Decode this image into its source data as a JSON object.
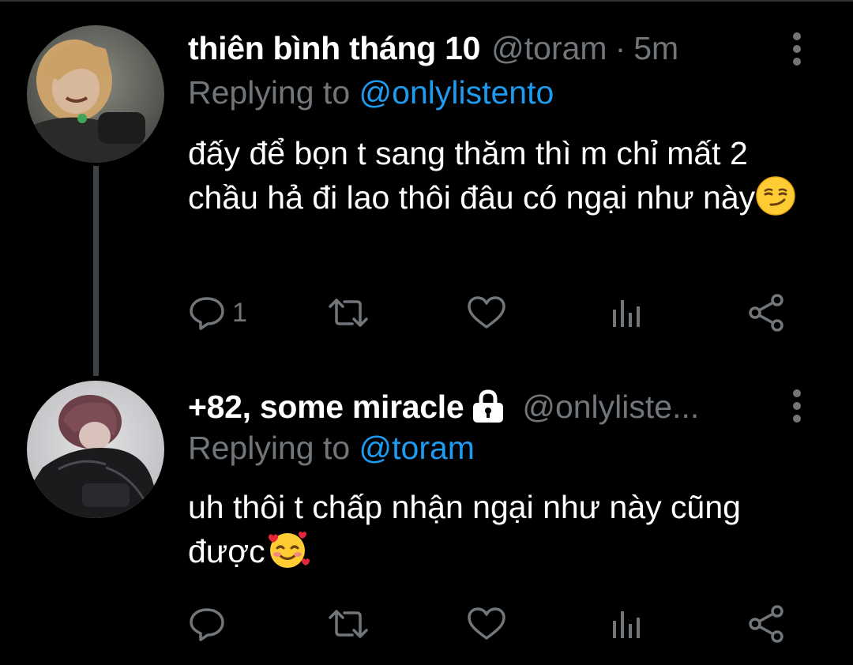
{
  "tweets": [
    {
      "display_name": "thiên bình tháng 10",
      "handle": "@toram",
      "separator": "·",
      "time": "5m",
      "replying_prefix": "Replying to",
      "replying_to": "@onlylistento",
      "text": "đấy để bọn t sang thăm thì m chỉ mất 2 chầu hả đi lao thôi đâu có ngại như này",
      "emoji": "smirking-face",
      "reply_count": "1",
      "verified_lock": false
    },
    {
      "display_name": "+82, some miracle",
      "handle": "@onlyliste...",
      "replying_prefix": "Replying to",
      "replying_to": "@toram",
      "text": "uh thôi t chấp nhận ngại như này cũng được",
      "emoji": "smiling-face-with-hearts",
      "reply_count": "",
      "verified_lock": true
    }
  ],
  "colors": {
    "background": "#000000",
    "text": "#ffffff",
    "secondary": "#71767b",
    "link": "#1d9bf0",
    "thread_line": "#3d4247"
  },
  "icons": {
    "reply": "comment-icon",
    "retweet": "retweet-icon",
    "like": "heart-icon",
    "views": "views-icon",
    "share": "share-icon",
    "more": "more-vertical-icon",
    "lock": "lock-icon"
  }
}
